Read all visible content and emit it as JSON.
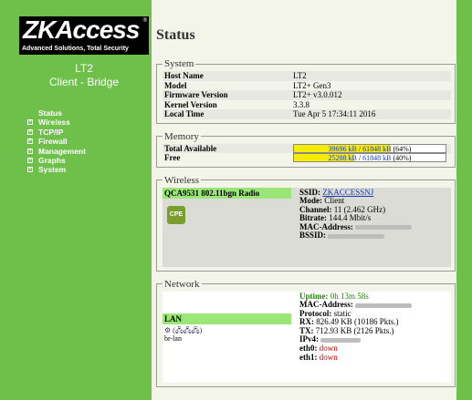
{
  "logo": {
    "text": "ZKAccess",
    "registered": "®",
    "tagline": "Advanced Solutions, Total Security"
  },
  "device": {
    "name": "LT2",
    "mode": "Client - Bridge"
  },
  "menu": [
    {
      "label": "Status",
      "expandable": false
    },
    {
      "label": "Wireless",
      "expandable": true
    },
    {
      "label": "TCP/IP",
      "expandable": true
    },
    {
      "label": "Firewall",
      "expandable": true
    },
    {
      "label": "Management",
      "expandable": true
    },
    {
      "label": "Graphs",
      "expandable": true
    },
    {
      "label": "System",
      "expandable": true
    }
  ],
  "page": {
    "title": "Status"
  },
  "system": {
    "legend": "System",
    "rows": [
      {
        "key": "Host Name",
        "value": "LT2"
      },
      {
        "key": "Model",
        "value": "LT2+ Gen3"
      },
      {
        "key": "Firmware Version",
        "value": "LT2+ v3.0.012"
      },
      {
        "key": "Kernel Version",
        "value": "3.3.8"
      },
      {
        "key": "Local Time",
        "value": "Tue Apr 5 17:34:11 2016"
      }
    ]
  },
  "memory": {
    "legend": "Memory",
    "total": {
      "label": "Total Available",
      "used": "39696 kB",
      "sep": " / ",
      "total": "61848 kB",
      "pct_text": " (64%)",
      "fraction": 0.64
    },
    "free": {
      "label": "Free",
      "used": "25288 kB",
      "sep": " / ",
      "total": "61848 kB",
      "pct_text": " (40%)",
      "fraction": 0.4
    }
  },
  "wireless": {
    "legend": "Wireless",
    "radio": "QCA9531 802.11bgn Radio",
    "icon": "CPE",
    "ssid_label": "SSID:",
    "ssid": "ZKACCESSNJ",
    "mode_label": "Mode:",
    "mode": "Client",
    "channel_label": "Channel:",
    "channel": "11 (2.462 GHz)",
    "bitrate_label": "Bitrate:",
    "bitrate": "144.4 Mbit/s",
    "mac_label": "MAC-Address:",
    "bssid_label": "BSSID:"
  },
  "network": {
    "legend": "Network",
    "uptime_label": "Uptime:",
    "uptime": "0h 13m 58s",
    "mac_label": "MAC-Address:",
    "protocol_label": "Protocol:",
    "protocol": "static",
    "rx_label": "RX:",
    "rx": "826.49 KB (10186 Pkts.)",
    "tx_label": "TX:",
    "tx": "712.93 KB (2126 Pkts.)",
    "ipv4_label": "IPv4:",
    "eth0_label": "eth0:",
    "eth0": "down",
    "eth1_label": "eth1:",
    "eth1": "down",
    "iface": "LAN",
    "iface_icons": "⚙ (🖧🖧🖧)",
    "iface_dev": "br-lan"
  },
  "colors": {
    "sidebar": "#6ec04a",
    "highlight": "#9ae778",
    "bar_fill": "#f6ec00",
    "down": "#dd0000",
    "uptime": "#1e8a00"
  }
}
